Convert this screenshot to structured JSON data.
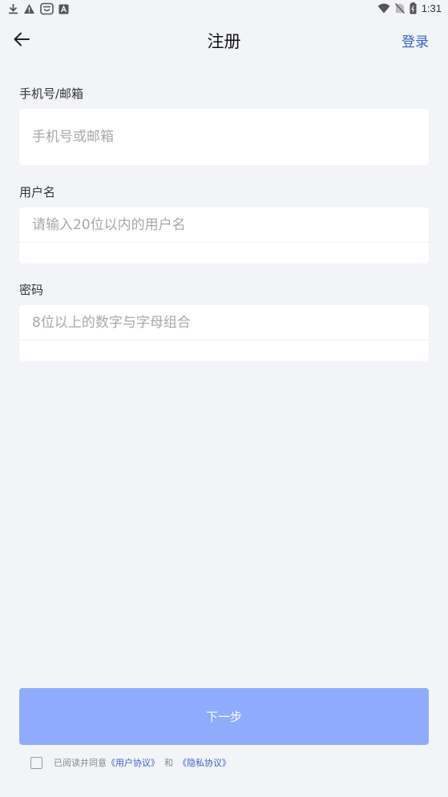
{
  "status_bar": {
    "time": "1:31",
    "left_icons": [
      "download-icon",
      "warning-icon",
      "notification-app-icon",
      "font-app-icon"
    ],
    "right_icons": [
      "wifi-icon",
      "no-sim-icon",
      "battery-icon"
    ]
  },
  "header": {
    "title": "注册",
    "login_label": "登录"
  },
  "form": {
    "account": {
      "label": "手机号/邮箱",
      "placeholder": "手机号或邮箱"
    },
    "username": {
      "label": "用户名",
      "placeholder": "请输入20位以内的用户名"
    },
    "password": {
      "label": "密码",
      "placeholder": "8位以上的数字与字母组合"
    }
  },
  "next_button": {
    "label": "下一步"
  },
  "agreement": {
    "prefix": "已阅读并同意",
    "user_agreement": "《用户协议》",
    "conjunction": "和",
    "privacy_policy": "《隐私协议》"
  },
  "colors": {
    "background": "#f2f4f8",
    "accent": "#3a62c9",
    "button": "#8fabfb"
  }
}
